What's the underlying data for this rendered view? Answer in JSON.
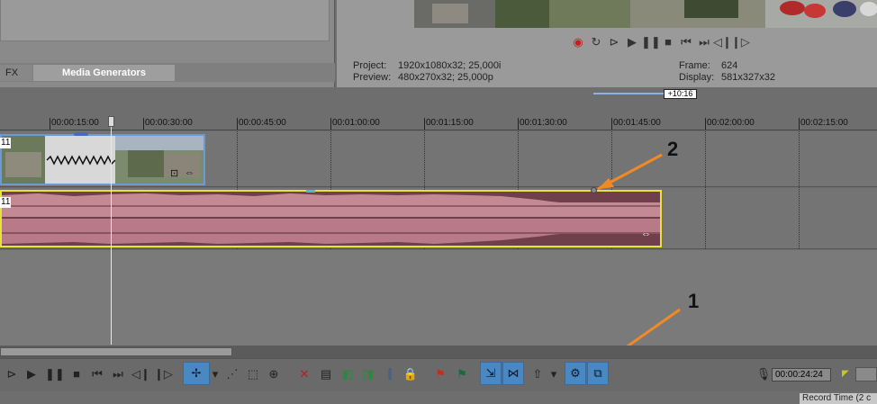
{
  "tabs": {
    "fx_label": "FX",
    "media_generators_label": "Media Generators"
  },
  "preview_info": {
    "project_label": "Project:",
    "project_value": "1920x1080x32; 25,000i",
    "preview_label": "Preview:",
    "preview_value": "480x270x32; 25,000p",
    "frame_label": "Frame:",
    "frame_value": "624",
    "display_label": "Display:",
    "display_value": "581x327x32"
  },
  "timeline": {
    "zoom_badge": "+10:16",
    "ruler_labels": [
      "00:00:15:00",
      "00:00:30:00",
      "00:00:45:00",
      "00:01:00:00",
      "00:01:15:00",
      "00:01:30:00",
      "00:01:45:00",
      "00:02:00:00",
      "00:02:15:00"
    ],
    "video_track_num": "11",
    "audio_track_num": "11"
  },
  "annotations": {
    "label_1": "1",
    "label_2": "2"
  },
  "status": {
    "time_value": "00:00:24:24",
    "record_time_label": "Record Time (2 c"
  },
  "colors": {
    "annotation_arrow": "#f08a24",
    "selected_tool": "#4a88c4",
    "audio_event": "#6f3f4c",
    "audio_border": "#e4e43c",
    "video_border": "#6c9ad8"
  }
}
